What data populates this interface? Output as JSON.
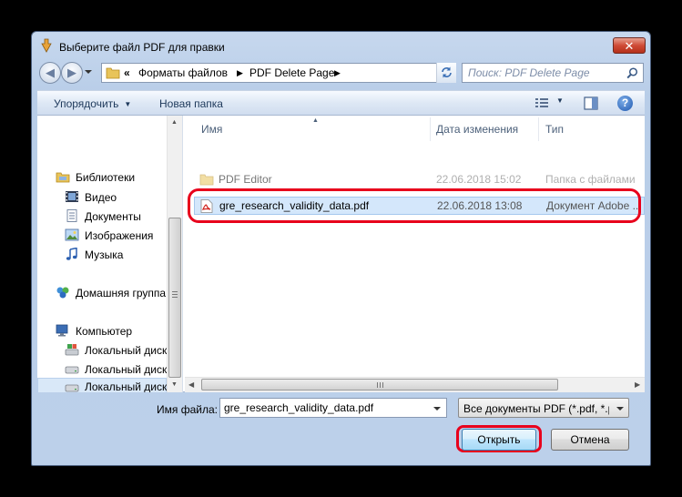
{
  "window": {
    "title": "Выберите файл PDF для правки",
    "close_label": "✕"
  },
  "nav": {
    "breadcrumb_prefix": "«",
    "breadcrumbs": [
      "Форматы файлов",
      "PDF Delete Page"
    ],
    "search_placeholder": "Поиск: PDF Delete Page"
  },
  "toolbar": {
    "organize_label": "Упорядочить",
    "new_folder_label": "Новая папка"
  },
  "sidebar": {
    "items": [
      {
        "label": "Библиотеки",
        "icon": "libraries-icon"
      },
      {
        "label": "Видео",
        "icon": "video-icon"
      },
      {
        "label": "Документы",
        "icon": "documents-icon"
      },
      {
        "label": "Изображения",
        "icon": "images-icon"
      },
      {
        "label": "Музыка",
        "icon": "music-icon"
      },
      {
        "label": "Домашняя группа",
        "icon": "homegroup-icon"
      },
      {
        "label": "Компьютер",
        "icon": "computer-icon"
      },
      {
        "label": "Локальный диск",
        "icon": "system-drive-icon"
      },
      {
        "label": "Локальный диск",
        "icon": "drive-icon"
      },
      {
        "label": "Локальный диск",
        "icon": "drive-icon"
      }
    ]
  },
  "files": {
    "columns": [
      "Имя",
      "Дата изменения",
      "Тип"
    ],
    "rows": [
      {
        "name": "PDF Editor",
        "date": "22.06.2018 15:02",
        "type": "Папка с файлами",
        "icon": "folder-icon"
      },
      {
        "name": "gre_research_validity_data.pdf",
        "date": "22.06.2018 13:08",
        "type": "Документ Adobe ...",
        "icon": "pdf-file-icon"
      }
    ]
  },
  "bottom": {
    "filename_label": "Имя файла:",
    "filename_value": "gre_research_validity_data.pdf",
    "filetype_value": "Все документы PDF (*.pdf, *.pdf",
    "open_label": "Открыть",
    "cancel_label": "Отмена"
  },
  "colors": {
    "highlight": "#e8001c",
    "selection": "#cce8ff",
    "window_frame": "#b8cde8"
  }
}
